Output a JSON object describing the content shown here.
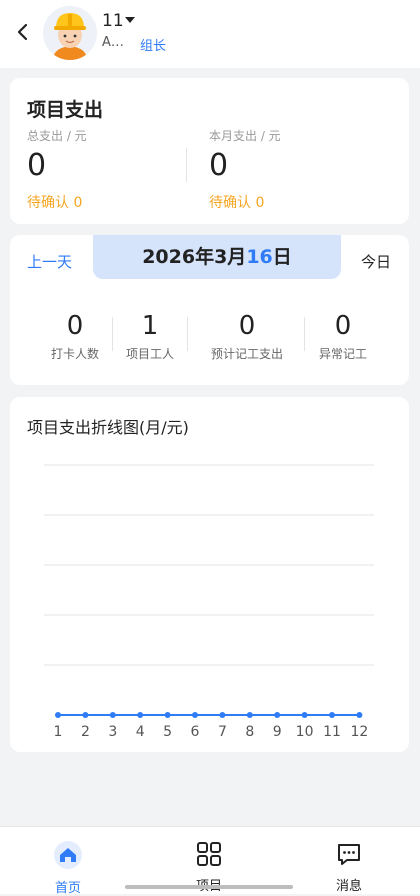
{
  "header": {
    "user_name": "11",
    "user_sub": "A…",
    "role": "组长"
  },
  "expense": {
    "title": "项目支出",
    "total_label": "总支出 / 元",
    "total_value": "0",
    "total_pending": "待确认  0",
    "month_label": "本月支出 / 元",
    "month_value": "0",
    "month_pending": "待确认  0"
  },
  "attendance": {
    "prev_day": "上一天",
    "date_prefix": "2026年3月",
    "date_day": "16",
    "date_suffix": "日",
    "today": "今日",
    "stats": [
      {
        "value": "0",
        "label": "打卡人数"
      },
      {
        "value": "1",
        "label": "项目工人"
      },
      {
        "value": "0",
        "label": "预计记工支出"
      },
      {
        "value": "0",
        "label": "异常记工"
      }
    ]
  },
  "chart_data": {
    "type": "line",
    "title": "项目支出折线图(月/元)",
    "xlabel": "",
    "ylabel": "",
    "x": [
      "1",
      "2",
      "3",
      "4",
      "5",
      "6",
      "7",
      "8",
      "9",
      "10",
      "11",
      "12"
    ],
    "series": [
      {
        "values": [
          0,
          0,
          0,
          0,
          0,
          0,
          0,
          0,
          0,
          0,
          0,
          0
        ]
      }
    ],
    "grid": true,
    "color": "#2f7cf6"
  },
  "tabbar": {
    "items": [
      {
        "label": "首页",
        "icon": "home-icon",
        "active": true
      },
      {
        "label": "项目",
        "icon": "grid-icon",
        "active": false
      },
      {
        "label": "消息",
        "icon": "message-icon",
        "active": false
      }
    ]
  },
  "colors": {
    "accent": "#2f7cf6",
    "pending": "#f5a623",
    "date_highlight": "#d5e3fb"
  }
}
